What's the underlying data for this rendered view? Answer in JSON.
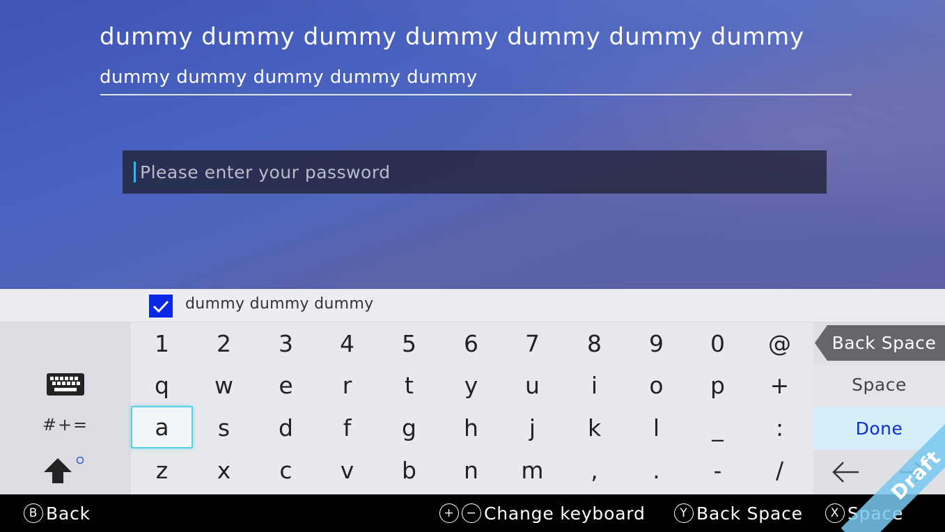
{
  "header": {
    "title": "dummy dummy dummy dummy dummy dummy dummy",
    "subtitle": "dummy dummy dummy dummy dummy"
  },
  "password_field": {
    "placeholder": "Please enter your password",
    "value": ""
  },
  "option": {
    "checked": true,
    "label": "dummy dummy dummy"
  },
  "keyboard": {
    "rows": [
      [
        "1",
        "2",
        "3",
        "4",
        "5",
        "6",
        "7",
        "8",
        "9",
        "0",
        "@"
      ],
      [
        "q",
        "w",
        "e",
        "r",
        "t",
        "y",
        "u",
        "i",
        "o",
        "p",
        "+"
      ],
      [
        "a",
        "s",
        "d",
        "f",
        "g",
        "h",
        "j",
        "k",
        "l",
        "_",
        ":"
      ],
      [
        "z",
        "x",
        "c",
        "v",
        "b",
        "n",
        "m",
        ",",
        ".",
        "-",
        "/"
      ]
    ],
    "selected_key": "a",
    "symbols_label": "#+=",
    "left_icons": [
      "keyboard-icon",
      "shift-arrow-icon"
    ],
    "backspace_label": "Back Space",
    "space_label": "Space",
    "done_label": "Done",
    "arrow_icons": [
      "left-arrow-icon",
      "right-arrow-icon"
    ]
  },
  "footer": {
    "back": {
      "button": "B",
      "label": "Back"
    },
    "change_keyboard": {
      "buttons": [
        "+",
        "−"
      ],
      "label": "Change keyboard"
    },
    "backspace": {
      "button": "Y",
      "label": "Back Space"
    },
    "space": {
      "button": "X",
      "label": "Space"
    }
  },
  "watermark": "Draft",
  "colors": {
    "accent_blue": "#0a27e6",
    "done_text": "#0c2cd8",
    "selection_border": "#55d0e6",
    "caret": "#37b4e8"
  }
}
